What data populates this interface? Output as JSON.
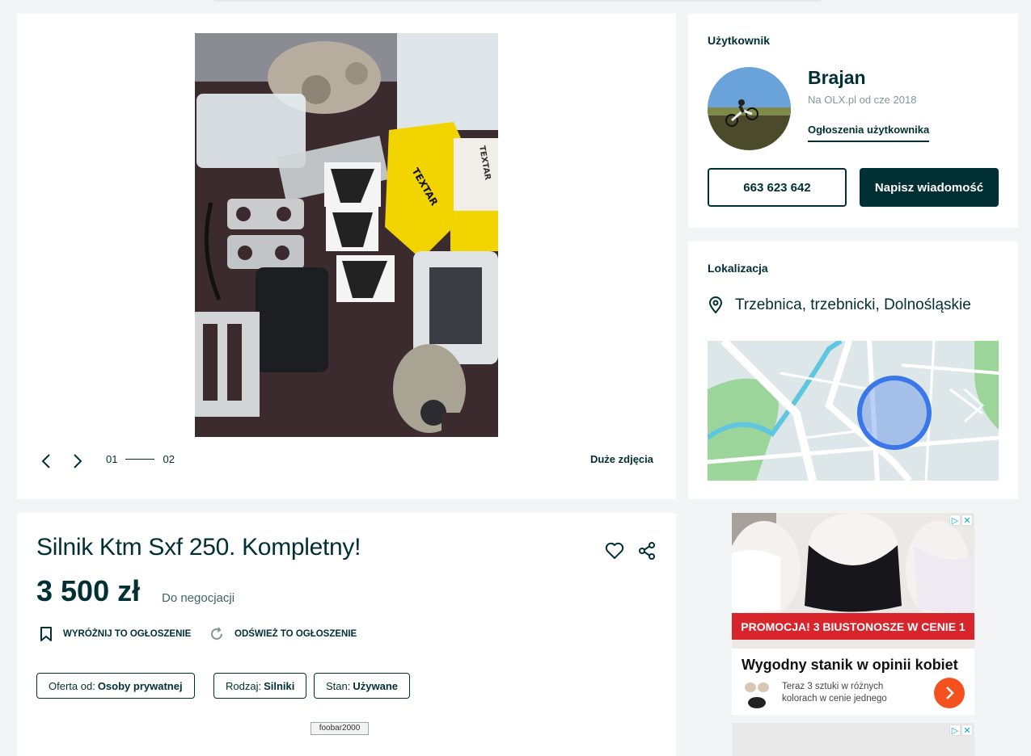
{
  "gallery": {
    "counter_current": "01",
    "counter_total": "02",
    "big_photos_label": "Duże zdjęcia",
    "photo_label_box1": "TEXTAR",
    "photo_label_box2": "TEXTAR"
  },
  "listing": {
    "title": "Silnik Ktm Sxf 250. Kompletny!",
    "price": "3 500 zł",
    "negotiable": "Do negocjacji",
    "feature_label": "Wyróżnij to ogłoszenie",
    "refresh_label": "Odśwież to ogłoszenie",
    "tags": [
      {
        "key": "Oferta od:",
        "value": "Osoby prywatnej"
      },
      {
        "key": "Rodzaj:",
        "value": "Silniki"
      },
      {
        "key": "Stan:",
        "value": "Używane"
      }
    ],
    "overlay_label": "foobar2000"
  },
  "user": {
    "section_title": "Użytkownik",
    "name": "Brajan",
    "since": "Na OLX.pl od cze 2018",
    "ads_link": "Ogłoszenia użytkownika",
    "phone": "663 623 642",
    "message_button": "Napisz wiadomość"
  },
  "location": {
    "section_title": "Lokalizacja",
    "place": "Trzebnica, trzebnicki, Dolnośląskie"
  },
  "ad": {
    "banner": "PROMOCJA! 3 BIUSTONOSZE W CENIE 1",
    "title": "Wygodny stanik w opinii kobiet",
    "description": "Teraz 3 sztuki w różnych kolorach w cenie jednego"
  },
  "colors": {
    "brand_dark": "#002f34",
    "background": "#f2f4f5",
    "map_pin": "#3a77e8",
    "ad_red": "#d8252c",
    "ad_orange": "#f4511e"
  }
}
